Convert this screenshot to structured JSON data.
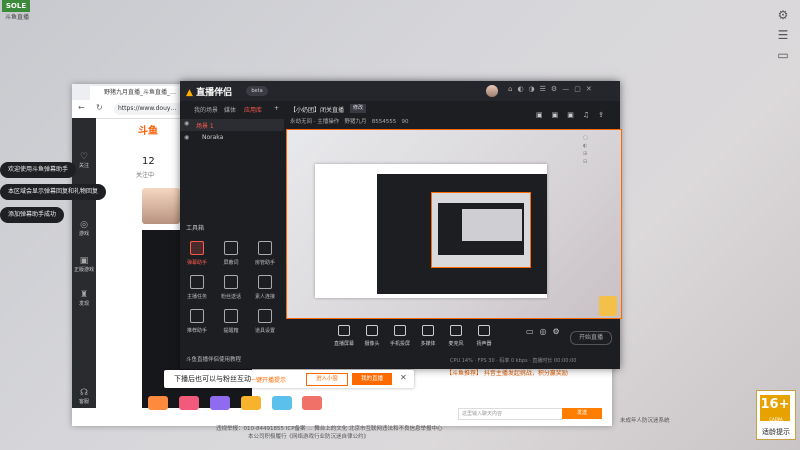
{
  "desktop": {
    "logo_text": "SOLE",
    "logo_sub": "斗鱼直播",
    "footer_line1": "违规举报：010-84491855 ICP备案 ... 舞台上的文化 北京市互联网违法和不良信息举报中心",
    "footer_line2": "本公司积极履行《网络游戏行业防沉迷自律公约》",
    "footer_right": "未成年人防沉迷系统"
  },
  "browser": {
    "tab_title": "野猪九月直播_斗鱼直播_…",
    "url": "https://www.douy…",
    "count": "12",
    "count_label": "关注中",
    "nav": [
      "关注",
      "游戏",
      "正版游戏",
      "发现",
      "客服"
    ],
    "chat_msg": "【斗鱼推荐】 抖音主播发起挑战，积分赢奖励",
    "chat_placeholder": "这里输入聊天内容",
    "send_label": "发送"
  },
  "tooltips": [
    "欢迎使用斗鱼弹幕助手",
    "本区域会显示弹幕回复和礼物回复",
    "添加弹幕助手成功"
  ],
  "app": {
    "name": "直播伴侣",
    "badge": "beta",
    "tabs": [
      "我的场景",
      "媒体",
      "应用库"
    ],
    "scene_name": "场景 1",
    "layer_name": "Noraka",
    "room_title": "【小奶团】闭关直播",
    "room_button": "修改",
    "room_sub": "永劫无间 · 主播操作",
    "room_sub2": "野猪九月",
    "room_id": "8554555",
    "room_fans": "90",
    "toolbox_label": "工具箱",
    "tools": [
      "弹幕助手",
      "屏蔽词",
      "房管助手",
      "主播任务",
      "粉丝送话",
      "素人连接",
      "推荐助手",
      "提醒箱",
      "道具设置"
    ],
    "controls": [
      "直播屏幕",
      "摄像头",
      "手机投屏",
      "多媒体",
      "麦克风",
      "扬声器"
    ],
    "start_label": "开始直播",
    "bottom_text": "斗鱼直播伴侣使用教程",
    "status": "CPU 14% · FPS 30 · 码率 0 kbps · 直播时长 00:00:00"
  },
  "banner": {
    "text": "下播后也可以与粉丝互动",
    "link": "一键开播提示",
    "btn_secondary": "进入小窗",
    "btn_primary": "我的直播",
    "close": "✕"
  },
  "age_badge": {
    "number": "16+",
    "sub": "CADPA",
    "label": "适龄提示"
  },
  "colors": {
    "accent": "#ff6a00",
    "app_bg": "#1d1e22",
    "red_tab": "#ff5a4e"
  }
}
